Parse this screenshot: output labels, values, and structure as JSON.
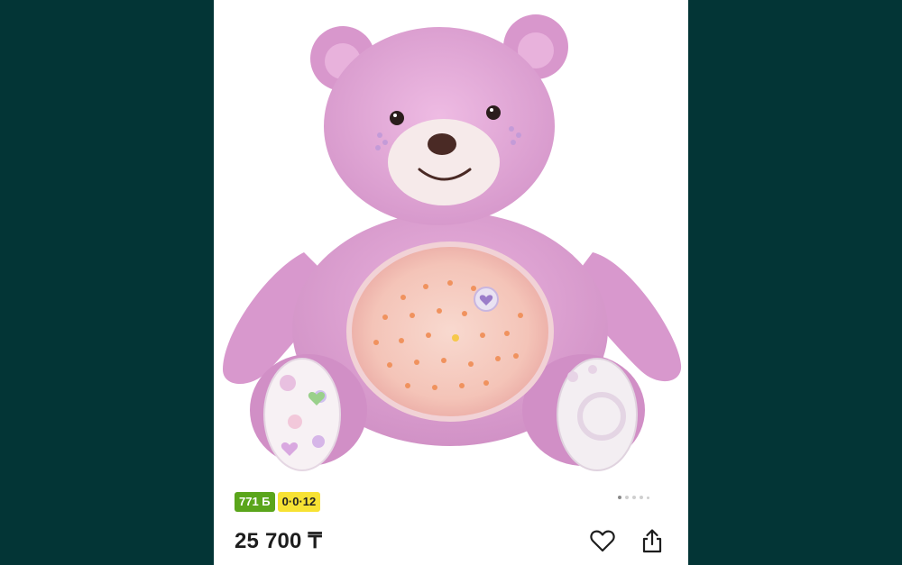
{
  "product": {
    "image_alt": "pink plush teddy bear with star projector belly",
    "price": "25 700 ₸",
    "badges": {
      "bonus": "771 Б",
      "installment": "0·0·12"
    },
    "gallery": {
      "total_pages": 5,
      "current_page": 1
    }
  },
  "actions": {
    "favorite_icon": "heart-icon",
    "share_icon": "share-icon"
  },
  "colors": {
    "background": "#033536",
    "bonus_badge": "#5aa51b",
    "installment_badge": "#f7e233",
    "bear_pink": "#e3a6d8"
  }
}
